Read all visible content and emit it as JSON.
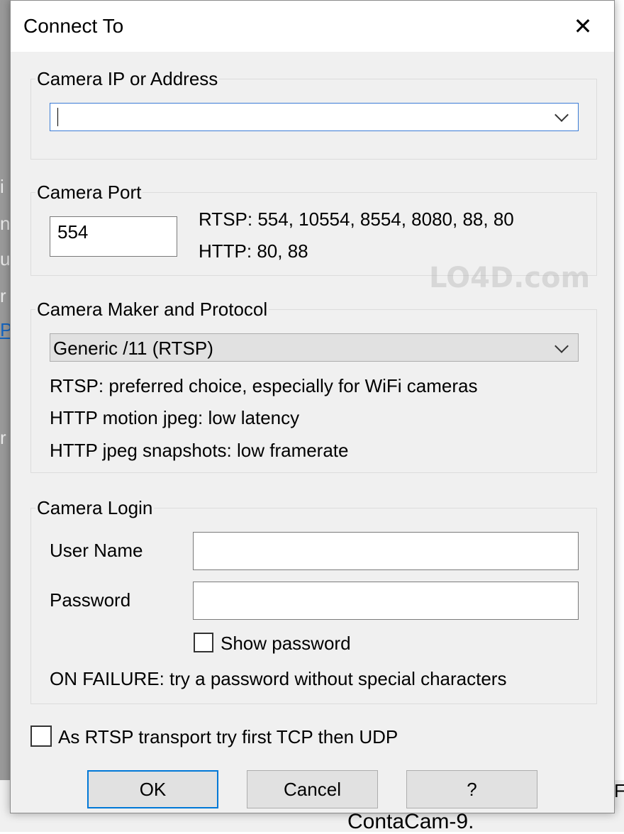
{
  "background": {
    "fragments": [
      "i",
      "n",
      "u",
      "r",
      "P",
      "r"
    ],
    "bottom_text": "ContaCam-9.",
    "bottom_right": "F"
  },
  "dialog": {
    "title": "Connect To",
    "close_glyph": "✕"
  },
  "address_group": {
    "label": "Camera IP or Address",
    "value": ""
  },
  "port_group": {
    "label": "Camera Port",
    "value": "554",
    "rtsp_ports": "RTSP: 554, 10554, 8554, 8080, 88, 80",
    "http_ports": "HTTP: 80, 88"
  },
  "maker_group": {
    "label": "Camera Maker and Protocol",
    "selected": "Generic /11 (RTSP)",
    "notes": [
      "RTSP: preferred choice, especially for WiFi cameras",
      "HTTP motion jpeg: low latency",
      "HTTP jpeg snapshots: low framerate"
    ]
  },
  "login_group": {
    "label": "Camera Login",
    "username_label": "User Name",
    "username_value": "",
    "password_label": "Password",
    "password_value": "",
    "show_password_label": "Show password",
    "failure_hint": "ON FAILURE: try a password without special characters"
  },
  "transport_checkbox_label": "As RTSP transport try first TCP then UDP",
  "buttons": {
    "ok": "OK",
    "cancel": "Cancel",
    "help": "?"
  },
  "watermark": "LO4D.com"
}
